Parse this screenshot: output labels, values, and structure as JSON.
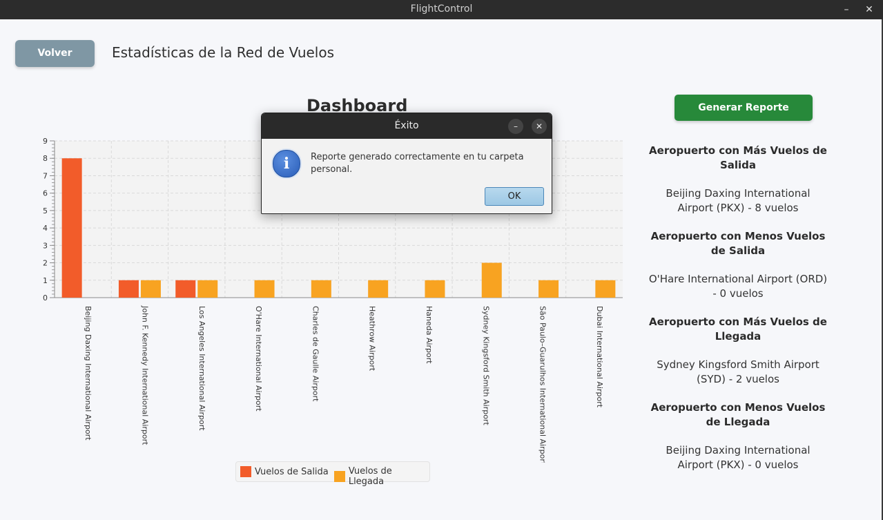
{
  "window": {
    "title": "FlightControl",
    "minimize_glyph": "–",
    "close_glyph": "✕"
  },
  "header": {
    "back_label": "Volver",
    "title": "Estadísticas de la Red de Vuelos"
  },
  "chart_title": "Dashboard",
  "chart_data": {
    "type": "bar",
    "title": "Dashboard",
    "xlabel": "",
    "ylabel": "",
    "ylim": [
      0,
      9
    ],
    "yticks": [
      0,
      1,
      2,
      3,
      4,
      5,
      6,
      7,
      8,
      9
    ],
    "grid": true,
    "legend": "bottom",
    "categories": [
      "Beijing Daxing International Airport",
      "John F. Kennedy International Airport",
      "Los Angeles International Airport",
      "O'Hare International Airport",
      "Charles de Gaulle Airport",
      "Heathrow Airport",
      "Haneda Airport",
      "Sydney Kingsford Smith Airport",
      "São Paulo–Guarulhos International Airport",
      "Dubai International Airport"
    ],
    "series": [
      {
        "name": "Vuelos de Salida",
        "color": "#f25c2a",
        "values": [
          8,
          1,
          1,
          0,
          0,
          0,
          0,
          0,
          0,
          0
        ]
      },
      {
        "name": "Vuelos de Llegada",
        "color": "#f8a321",
        "values": [
          0,
          1,
          1,
          1,
          1,
          1,
          1,
          2,
          1,
          1
        ]
      }
    ]
  },
  "legend": {
    "departures": "Vuelos de Salida",
    "arrivals": "Vuelos de Llegada",
    "departures_color": "#f25c2a",
    "arrivals_color": "#f8a321"
  },
  "sidebar": {
    "report_button": "Generar Reporte",
    "stats": [
      {
        "heading": "Aeropuerto con Más Vuelos de Salida",
        "value": "Beijing Daxing International Airport (PKX) - 8 vuelos"
      },
      {
        "heading": "Aeropuerto con Menos Vuelos de Salida",
        "value": "O'Hare International Airport (ORD) - 0 vuelos"
      },
      {
        "heading": "Aeropuerto con Más Vuelos de Llegada",
        "value": "Sydney Kingsford Smith Airport (SYD) - 2 vuelos"
      },
      {
        "heading": "Aeropuerto con Menos Vuelos de Llegada",
        "value": "Beijing Daxing International Airport (PKX) - 0 vuelos"
      }
    ]
  },
  "dialog": {
    "title": "Éxito",
    "minimize_glyph": "–",
    "close_glyph": "✕",
    "icon": "info-icon",
    "icon_glyph": "i",
    "message": "Reporte generado correctamente en tu carpeta personal.",
    "ok_label": "OK"
  }
}
